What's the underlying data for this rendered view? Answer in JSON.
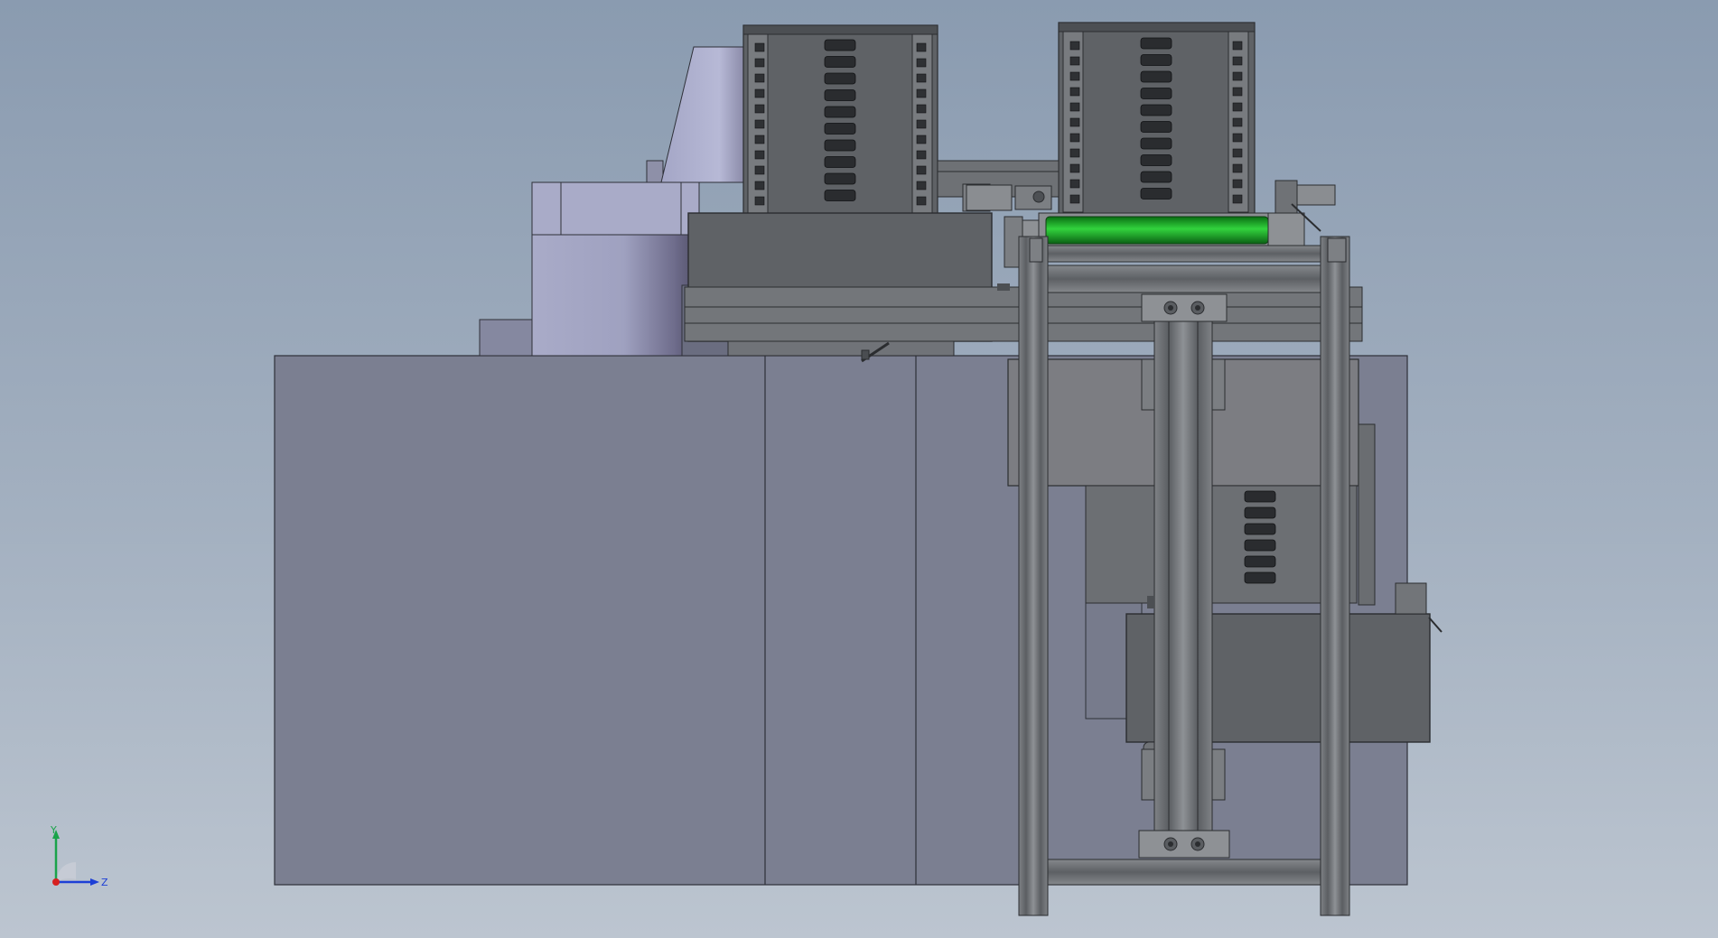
{
  "viewport": {
    "background_top": "#8a9bb0",
    "background_bottom": "#bcc5d0"
  },
  "colors": {
    "housing": "#7b7f91",
    "housing_edge": "#2e3038",
    "panel_dark": "#5f6266",
    "frame_profile": "#6b6e72",
    "frame_light": "#9a9da1",
    "cylinder_light": "#a9abc8",
    "cylinder_dark": "#5e5c7a",
    "roller_green": "#1fa32a",
    "slot_dark": "#2a2c2f"
  },
  "triad": {
    "y_label": "Y",
    "z_label": "Z",
    "y_color": "#1aa34a",
    "z_color": "#1d3fd6",
    "origin_color": "#d62020"
  }
}
